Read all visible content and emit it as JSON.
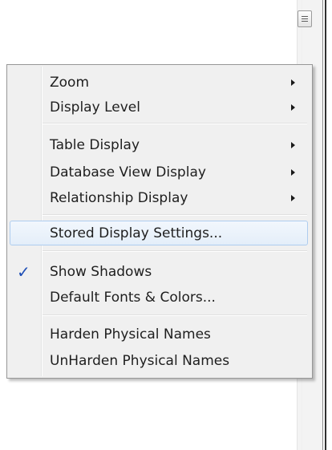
{
  "menu": {
    "items": [
      {
        "label": "Zoom",
        "submenu": true
      },
      {
        "label": "Display Level",
        "submenu": true
      },
      {
        "label": "Table Display",
        "submenu": true
      },
      {
        "label": "Database View Display",
        "submenu": true
      },
      {
        "label": "Relationship Display",
        "submenu": true
      },
      {
        "label": "Stored Display Settings...",
        "highlighted": true
      },
      {
        "label": "Show Shadows",
        "checked": true,
        "check_glyph": "✓"
      },
      {
        "label": "Default Fonts & Colors..."
      },
      {
        "label": "Harden Physical Names"
      },
      {
        "label": "UnHarden Physical Names"
      }
    ]
  },
  "colors": {
    "menu_background": "#f0f0f0",
    "highlight_border": "#aeccef",
    "check_color": "#1f4fb6"
  }
}
